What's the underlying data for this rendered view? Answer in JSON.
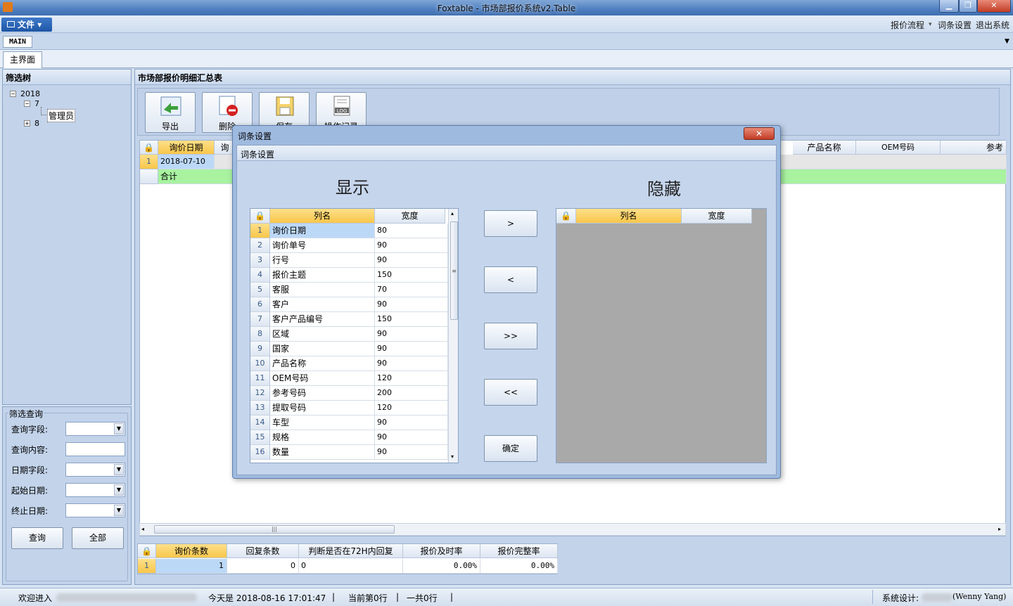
{
  "window": {
    "title": "Foxtable - 市场部报价系统v2.Table",
    "min": "▁",
    "max": "❐",
    "close": "✕"
  },
  "menu": {
    "file_label": "文件",
    "links": [
      "报价流程",
      "词条设置",
      "退出系统"
    ],
    "main_tab": "MAIN",
    "page_tab": "主界面"
  },
  "tree": {
    "header": "筛选树",
    "nodes": [
      "2018",
      "7",
      "管理员",
      "8"
    ]
  },
  "filter": {
    "header": "筛选查询",
    "labels": [
      "查询字段:",
      "查询内容:",
      "日期字段:",
      "起始日期:",
      "终止日期:"
    ],
    "query_button": "查询",
    "all_button": "全部"
  },
  "content": {
    "header": "市场部报价明细汇总表",
    "toolbar": [
      "导出",
      "删除",
      "保存",
      "操作记录"
    ],
    "grid_headers": [
      "询价日期",
      "询",
      "产品名称",
      "OEM号码",
      "参考"
    ],
    "rows": [
      {
        "num": "1",
        "date": "2018-07-10"
      },
      {
        "num": "",
        "date": "合计"
      }
    ],
    "summary_headers": [
      "询价条数",
      "回复条数",
      "判断是否在72H内回复",
      "报价及时率",
      "报价完整率"
    ],
    "summary_row": {
      "num": "1",
      "values": [
        "1",
        "0",
        "0",
        "0.00%",
        "0.00%"
      ]
    }
  },
  "dialog": {
    "title": "词条设置",
    "subheader": "词条设置",
    "show_title": "显示",
    "hide_title": "隐藏",
    "col_name": "列名",
    "col_width": "宽度",
    "rows": [
      {
        "n": "1",
        "name": "询价日期",
        "width": "80"
      },
      {
        "n": "2",
        "name": "询价单号",
        "width": "90"
      },
      {
        "n": "3",
        "name": "行号",
        "width": "90"
      },
      {
        "n": "4",
        "name": "报价主题",
        "width": "150"
      },
      {
        "n": "5",
        "name": "客服",
        "width": "70"
      },
      {
        "n": "6",
        "name": "客户",
        "width": "90"
      },
      {
        "n": "7",
        "name": "客户产品编号",
        "width": "150"
      },
      {
        "n": "8",
        "name": "区域",
        "width": "90"
      },
      {
        "n": "9",
        "name": "国家",
        "width": "90"
      },
      {
        "n": "10",
        "name": "产品名称",
        "width": "90"
      },
      {
        "n": "11",
        "name": "OEM号码",
        "width": "120"
      },
      {
        "n": "12",
        "name": "参考号码",
        "width": "200"
      },
      {
        "n": "13",
        "name": "提取号码",
        "width": "120"
      },
      {
        "n": "14",
        "name": "车型",
        "width": "90"
      },
      {
        "n": "15",
        "name": "规格",
        "width": "90"
      },
      {
        "n": "16",
        "name": "数量",
        "width": "90"
      }
    ],
    "buttons": [
      ">",
      "<",
      ">>",
      "<<",
      "确定"
    ]
  },
  "status": {
    "welcome": "欢迎进入",
    "today": "今天是 2018-08-16 17:01:47",
    "current_row": "当前第0行",
    "total_rows": "一共0行",
    "designer": "系统设计:",
    "designer_name": "(Wenny Yang)"
  },
  "colors": {
    "accent": "#1d56a6",
    "selected_header": "#f8c64a",
    "selected_cell": "#bcd8f7",
    "total_row": "#a8f2a0"
  }
}
